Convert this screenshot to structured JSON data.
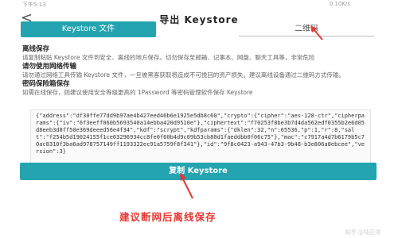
{
  "status_bar": {
    "time": "下午5:13",
    "right": "0.10K/s"
  },
  "nav": {
    "back_glyph": "<",
    "title": "导出 Keystore"
  },
  "tabs": [
    {
      "label": "Keystore 文件",
      "active": true
    },
    {
      "label": "二维码",
      "active": false
    }
  ],
  "sections": [
    {
      "title": "离线保存",
      "body": "请复制粘贴 Keystore 文件到安全、离线的地方保存。切勿保存至邮箱、记事本、网盘、聊天工具等，非常危险"
    },
    {
      "title": "请勿使用网络传输",
      "body": "请勿通过网络工具传输 Keystore 文件，一旦被黑客获取将造成不可挽回的资产损失。建议离线设备通过二维码方式传输。"
    },
    {
      "title": "密码保险箱保存",
      "body": "如需在线保存，则建议使用安全等级更高的 1Password 等密码管理软件保存 Keystore"
    }
  ],
  "keystore": {
    "text": "{\"address\":\"df30ffe77dd9b97ae4b427eed46b6e1925e5db8c60\",\"crypto\":{\"cipher\":\"aes-128-ctr\",\"cipherparams\":{\"iv\":\"6f3eeff060b5693540a14ebba420d9510e\"},\"ciphertext\":\"f70253f8be3b7d4da562edf0355b2e6d05d8eeb3d8ff50e369deeed56e4f34\",\"kdf\":\"scrypt\",\"kdfparams\":{\"dklen\":32,\"n\":65536,\"p\":1,\"r\":8,\"salt\":\"f254b5d19024155f1ce03296934cc8fe0f60b4d9c09b53cb80d1faeddbb0f06c75\"},\"mac\":\"c7917a4d7b6179b5c70ac8310f3ba6ad978757149ff1193322ec91a5759f8f341\"},\"id\":\"9f8c0423-a943-47b3-9b48-b3e806a8ebcee\",\"version\":3}"
  },
  "copy_button_label": "复制 Keystore",
  "annotation": "建议断网后离线保存",
  "watermark": "知乎 @陆区块",
  "colors": {
    "accent": "#23a4b0",
    "annotation_red": "#e53935"
  }
}
